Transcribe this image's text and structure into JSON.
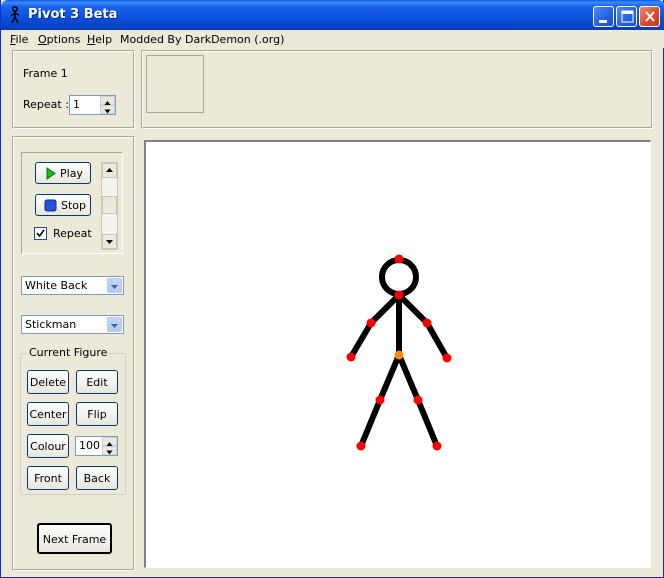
{
  "window": {
    "title": "Pivot 3 Beta"
  },
  "menu": [
    {
      "label": "File",
      "accel": "F",
      "rest": "ile"
    },
    {
      "label": "Options",
      "accel": "O",
      "rest": "ptions"
    },
    {
      "label": "Help",
      "accel": "H",
      "rest": "elp"
    },
    {
      "label": "Modded By DarkDemon (.org)",
      "accel": "",
      "rest": "Modded By DarkDemon (.org)"
    }
  ],
  "frame_panel": {
    "frame_label": "Frame 1",
    "repeat_label": "Repeat :",
    "repeat_value": "1"
  },
  "playback": {
    "play_label": "Play",
    "stop_label": "Stop",
    "repeat_label": "Repeat",
    "repeat_checked": true
  },
  "background_select": {
    "value": "White Back"
  },
  "figure_type_select": {
    "value": "Stickman"
  },
  "current_figure": {
    "title": "Current Figure",
    "delete_label": "Delete",
    "edit_label": "Edit",
    "center_label": "Center",
    "flip_label": "Flip",
    "colour_label": "Colour",
    "colour_value": "100",
    "front_label": "Front",
    "back_label": "Back"
  },
  "next_frame_label": "Next Frame",
  "colors": {
    "handle_red": "#ff0000",
    "handle_orange": "#ff8c00",
    "stick": "#000000"
  }
}
